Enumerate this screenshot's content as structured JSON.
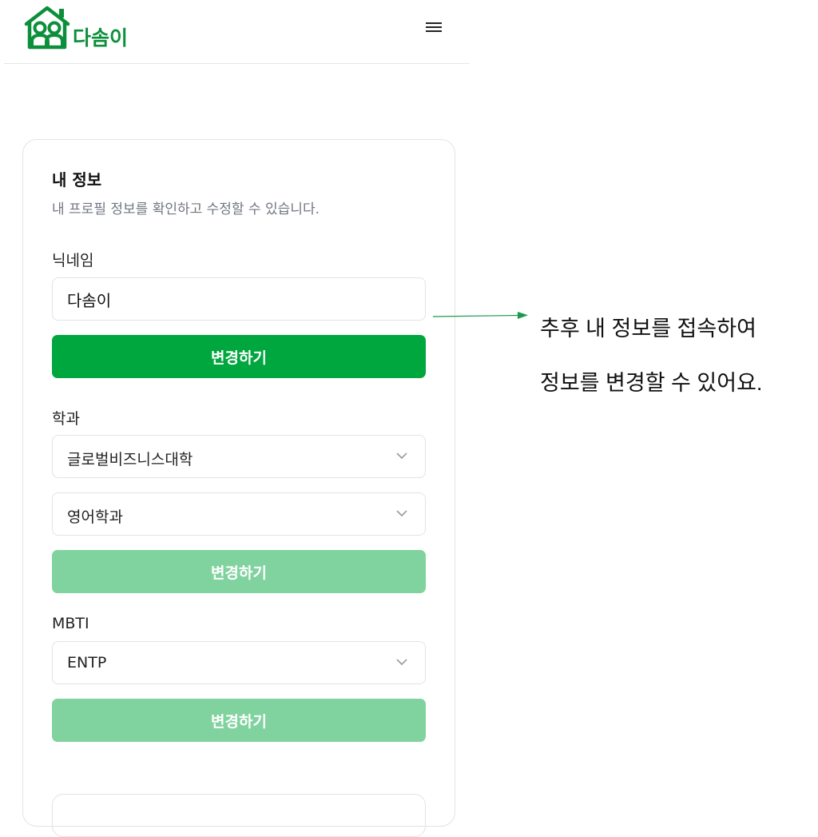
{
  "app": {
    "logo_text": "다솜이"
  },
  "profile": {
    "title": "내 정보",
    "subtitle": "내 프로필 정보를 확인하고 수정할 수 있습니다.",
    "nickname": {
      "label": "닉네임",
      "value": "다솜이",
      "button": "변경하기"
    },
    "department": {
      "label": "학과",
      "college": "글로벌비즈니스대학",
      "major": "영어학과",
      "button": "변경하기"
    },
    "mbti": {
      "label": "MBTI",
      "value": "ENTP",
      "button": "변경하기"
    }
  },
  "annotation": {
    "line1": "추후 내 정보를 접속하여",
    "line2": "정보를 변경할 수 있어요."
  },
  "colors": {
    "brand": "#0c8f3a",
    "button_active": "#00a63e",
    "button_disabled": "#80d39e"
  }
}
